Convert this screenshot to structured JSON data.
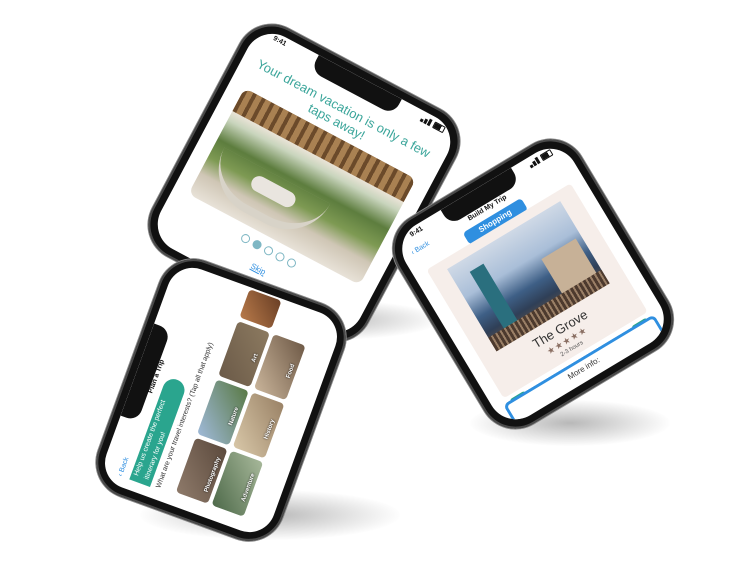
{
  "status": {
    "time": "9:41"
  },
  "onboarding": {
    "headline": "Your dream vacation is only a few taps away!",
    "skip_label": "Skip",
    "page_count": 5,
    "active_page": 2
  },
  "trip_builder": {
    "back_label": "Back",
    "title": "Build My Trip",
    "category": "Shopping",
    "place_name": "The Grove",
    "rating": 4,
    "rating_text": "★★★★★",
    "duration": "2-3 hours",
    "more_info_label": "More info:"
  },
  "plan_trip": {
    "back_label": "Back",
    "title": "Plan a Trip",
    "intro": "Help us create the perfect itinerary for you!",
    "question": "What are your travel interests? (Tap all that apply)",
    "interests": [
      "Photography",
      "Nature",
      "Art",
      "Adventure",
      "History",
      "Food"
    ]
  },
  "colors": {
    "teal": "#2aa58e",
    "blue": "#2f8fe0",
    "headline_teal": "#3aa59a"
  }
}
